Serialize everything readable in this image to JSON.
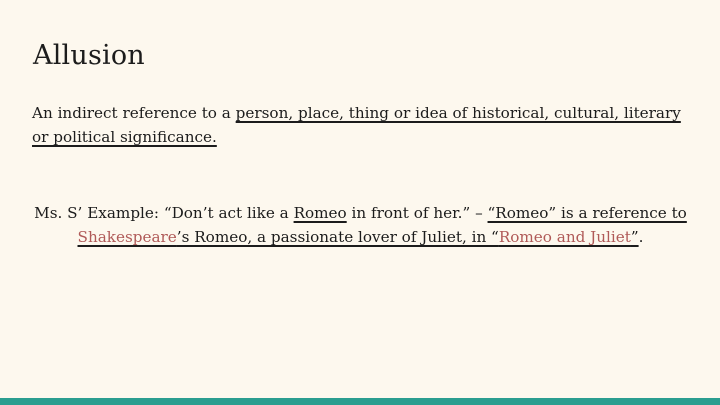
{
  "slide": {
    "title": "Allusion",
    "definition": {
      "intro": "An indirect reference to a ",
      "underlined": "person, place, thing or idea of historical, cultural, literary or political significance."
    },
    "example": {
      "lead": "Ms. S’ Example: “Don’t act like a ",
      "romeo_word": "Romeo",
      "mid": " in front of her.” – ",
      "ref_start": "“Romeo” is a reference to ",
      "shakespeare_link": "Shakespeare",
      "ref_mid": "’s Romeo, a passionate lover of Juliet, in “",
      "play_link": "Romeo and Juliet",
      "ref_end": "”",
      "period": "."
    }
  },
  "colors": {
    "background": "#fdf8ee",
    "text": "#1c1c1c",
    "link": "#b05a58",
    "accent_bar": "#2a9d8f"
  }
}
